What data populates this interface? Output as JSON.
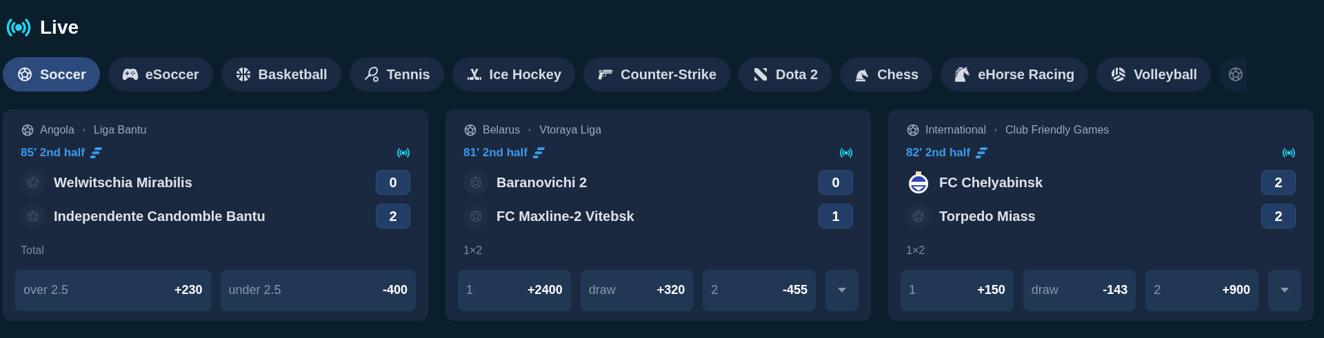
{
  "header": {
    "title": "Live"
  },
  "tabs": [
    {
      "label": "Soccer",
      "kind": "soccer",
      "selected": true
    },
    {
      "label": "eSoccer",
      "kind": "esoccer",
      "selected": false
    },
    {
      "label": "Basketball",
      "kind": "basketball",
      "selected": false
    },
    {
      "label": "Tennis",
      "kind": "tennis",
      "selected": false
    },
    {
      "label": "Ice Hockey",
      "kind": "hockey",
      "selected": false
    },
    {
      "label": "Counter-Strike",
      "kind": "shooter",
      "selected": false
    },
    {
      "label": "Dota 2",
      "kind": "dota",
      "selected": false
    },
    {
      "label": "Chess",
      "kind": "chess",
      "selected": false
    },
    {
      "label": "eHorse Racing",
      "kind": "ehorse",
      "selected": false
    },
    {
      "label": "Volleyball",
      "kind": "volleyball",
      "selected": false
    },
    {
      "kind": "partial",
      "selected": false
    }
  ],
  "matches": [
    {
      "country": "Angola",
      "league": "Liga Bantu",
      "time": "85′ 2nd half",
      "teams": [
        {
          "name": "Welwitschia Mirabilis",
          "score": "0",
          "kind": "placeholder"
        },
        {
          "name": "Independente Candomble Bantu",
          "score": "2",
          "kind": "placeholder"
        }
      ],
      "market": "Total",
      "outcomes": [
        {
          "label": "over 2.5",
          "odds": "+230"
        },
        {
          "label": "under 2.5",
          "odds": "-400"
        }
      ],
      "more": false
    },
    {
      "country": "Belarus",
      "league": "Vtoraya Liga",
      "time": "81′ 2nd half",
      "teams": [
        {
          "name": "Baranovichi 2",
          "score": "0",
          "kind": "placeholder"
        },
        {
          "name": "FC Maxline-2 Vitebsk",
          "score": "1",
          "kind": "placeholder"
        }
      ],
      "market": "1×2",
      "outcomes": [
        {
          "label": "1",
          "odds": "+2400"
        },
        {
          "label": "draw",
          "odds": "+320"
        },
        {
          "label": "2",
          "odds": "-455"
        }
      ],
      "more": true
    },
    {
      "country": "International",
      "league": "Club Friendly Games",
      "time": "82′ 2nd half",
      "teams": [
        {
          "name": "FC Chelyabinsk",
          "score": "2",
          "kind": "crest"
        },
        {
          "name": "Torpedo Miass",
          "score": "2",
          "kind": "placeholder"
        }
      ],
      "market": "1×2",
      "outcomes": [
        {
          "label": "1",
          "odds": "+150"
        },
        {
          "label": "draw",
          "odds": "-143"
        },
        {
          "label": "2",
          "odds": "+900"
        }
      ],
      "more": true
    }
  ]
}
